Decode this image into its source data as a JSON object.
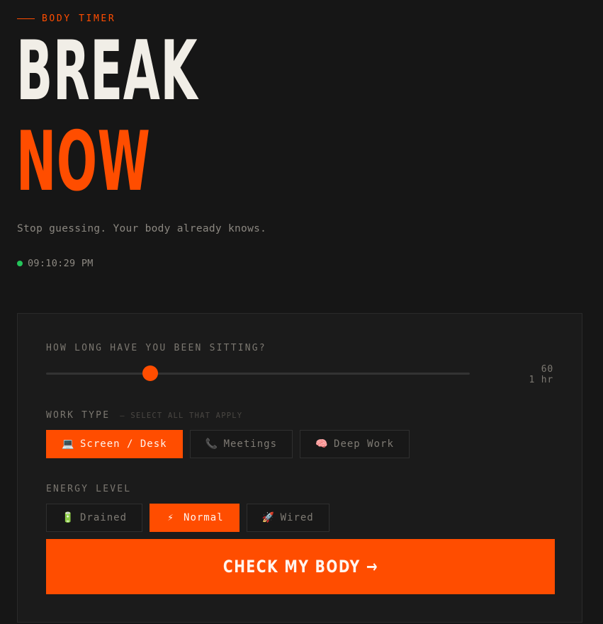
{
  "header": {
    "eyebrow": "BODY TIMER",
    "headline_line1": "BREAK",
    "headline_line2": "NOW",
    "tagline": "Stop guessing. Your body already knows.",
    "clock": "09:10:29 PM",
    "clock_status_color": "#24c45a"
  },
  "form": {
    "sitting": {
      "label": "HOW LONG HAVE YOU BEEN SITTING?",
      "value": 60,
      "value_text": "60",
      "value_unit": "1 hr",
      "fraction": 0.245
    },
    "work_type": {
      "label": "WORK TYPE",
      "sublabel": "— SELECT ALL THAT APPLY",
      "options": [
        {
          "icon": "laptop-icon",
          "glyph": "💻",
          "label": "Screen / Desk",
          "selected": true
        },
        {
          "icon": "phone-icon",
          "glyph": "📞",
          "label": "Meetings",
          "selected": false
        },
        {
          "icon": "brain-icon",
          "glyph": "🧠",
          "label": "Deep Work",
          "selected": false
        }
      ]
    },
    "energy": {
      "label": "ENERGY LEVEL",
      "options": [
        {
          "icon": "battery-icon",
          "glyph": "🔋",
          "label": "Drained",
          "selected": false
        },
        {
          "icon": "lightning-icon",
          "glyph": "⚡",
          "label": "Normal",
          "selected": true
        },
        {
          "icon": "rocket-icon",
          "glyph": "🚀",
          "label": "Wired",
          "selected": false
        }
      ]
    },
    "submit_label": "CHECK MY BODY →"
  },
  "colors": {
    "accent": "#ff4d00",
    "background": "#161616",
    "card": "#1b1b1b"
  }
}
